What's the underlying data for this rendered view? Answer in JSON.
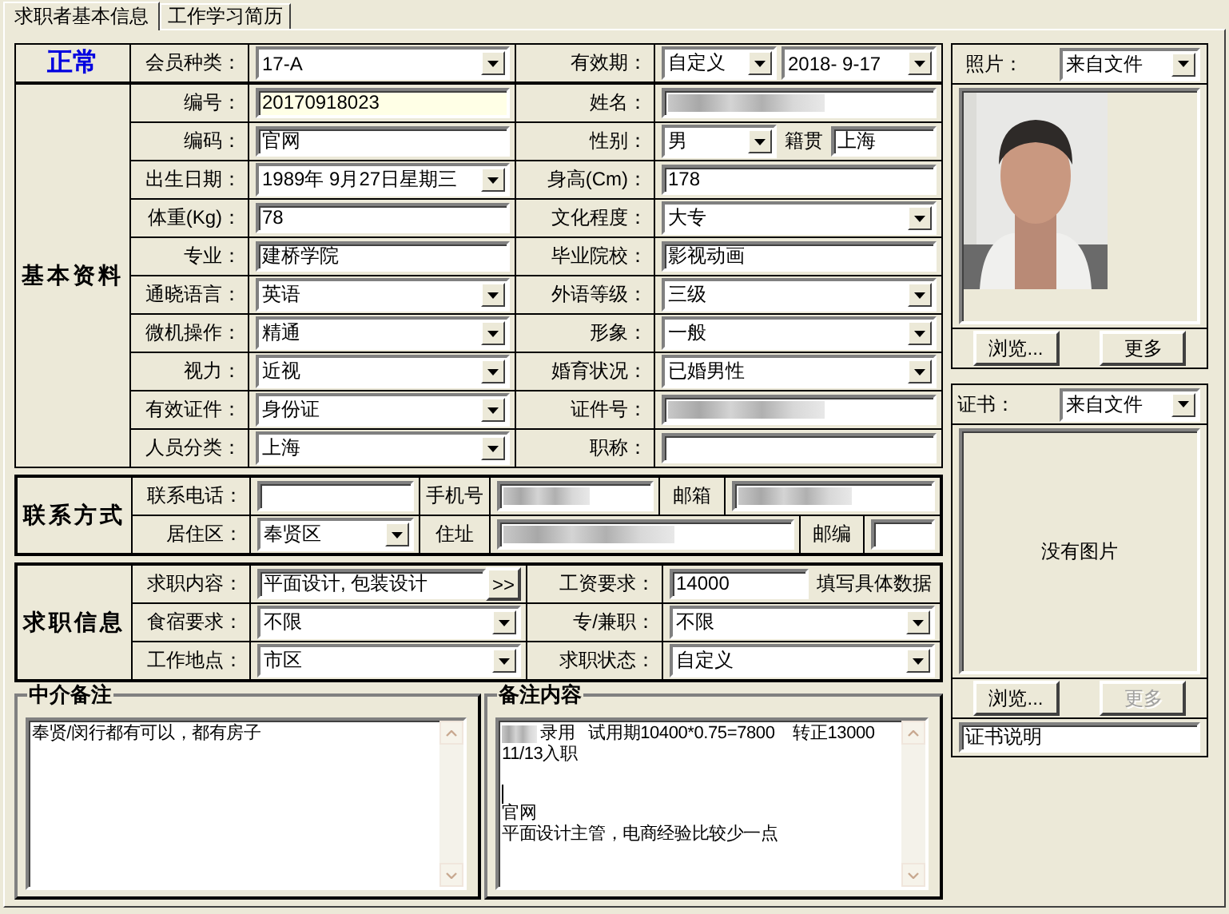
{
  "tabs": [
    {
      "label": "求职者基本信息",
      "selected": true
    },
    {
      "label": "工作学习简历",
      "selected": false
    }
  ],
  "form": {
    "sections": [
      {
        "kind": "header",
        "title": "正常",
        "rows": [
          [
            {
              "kind": "label",
              "text": "会员种类："
            },
            {
              "kind": "combo",
              "value": "17-A"
            },
            {
              "kind": "label",
              "text": "有效期："
            },
            {
              "kind": "group",
              "items": [
                {
                  "kind": "combo",
                  "value": "自定义"
                },
                {
                  "kind": "combo",
                  "value": "2018- 9-17"
                }
              ]
            }
          ]
        ]
      },
      {
        "kind": "basic",
        "title": "基本资料",
        "rows": [
          [
            {
              "kind": "label",
              "text": "编号："
            },
            {
              "kind": "field",
              "value": "20170918023",
              "highlighted": true
            },
            {
              "kind": "label",
              "text": "姓名："
            },
            {
              "kind": "field",
              "redacted": true,
              "highlighted": false
            }
          ],
          [
            {
              "kind": "label",
              "text": "编码："
            },
            {
              "kind": "field",
              "value": "官网",
              "highlighted": false
            },
            {
              "kind": "label",
              "text": "性别："
            },
            {
              "kind": "group",
              "items": [
                {
                  "kind": "combo",
                  "value": "男"
                },
                {
                  "kind": "text",
                  "text": "籍贯"
                },
                {
                  "kind": "field",
                  "value": "上海",
                  "highlighted": false
                }
              ]
            }
          ],
          [
            {
              "kind": "label",
              "text": "出生日期："
            },
            {
              "kind": "combo",
              "value": "1989年 9月27日星期三"
            },
            {
              "kind": "label",
              "text": "身高(Cm)："
            },
            {
              "kind": "field",
              "value": "178",
              "highlighted": false
            }
          ],
          [
            {
              "kind": "label",
              "text": "体重(Kg)："
            },
            {
              "kind": "field",
              "value": "78",
              "highlighted": false
            },
            {
              "kind": "label",
              "text": "文化程度："
            },
            {
              "kind": "combo",
              "value": "大专"
            }
          ],
          [
            {
              "kind": "label",
              "text": "专业："
            },
            {
              "kind": "field",
              "value": "建桥学院",
              "highlighted": false
            },
            {
              "kind": "label",
              "text": "毕业院校："
            },
            {
              "kind": "field",
              "value": "影视动画",
              "highlighted": false
            }
          ],
          [
            {
              "kind": "label",
              "text": "通晓语言："
            },
            {
              "kind": "combo",
              "value": "英语"
            },
            {
              "kind": "label",
              "text": "外语等级："
            },
            {
              "kind": "combo",
              "value": "三级"
            }
          ],
          [
            {
              "kind": "label",
              "text": "微机操作："
            },
            {
              "kind": "combo",
              "value": "精通"
            },
            {
              "kind": "label",
              "text": "形象："
            },
            {
              "kind": "combo",
              "value": "一般"
            }
          ],
          [
            {
              "kind": "label",
              "text": "视力："
            },
            {
              "kind": "combo",
              "value": "近视"
            },
            {
              "kind": "label",
              "text": "婚育状况："
            },
            {
              "kind": "combo",
              "value": "已婚男性"
            }
          ],
          [
            {
              "kind": "label",
              "text": "有效证件："
            },
            {
              "kind": "combo",
              "value": "身份证"
            },
            {
              "kind": "label",
              "text": "证件号："
            },
            {
              "kind": "field",
              "redacted": true,
              "highlighted": false
            }
          ],
          [
            {
              "kind": "label",
              "text": "人员分类："
            },
            {
              "kind": "combo",
              "value": "上海"
            },
            {
              "kind": "label",
              "text": "职称："
            },
            {
              "kind": "field",
              "highlighted": false
            }
          ]
        ]
      },
      {
        "kind": "contact",
        "title": "联系方式",
        "rows": [
          [
            {
              "kind": "label",
              "text": "联系电话："
            },
            {
              "kind": "field",
              "highlighted": false
            },
            {
              "kind": "label",
              "text": "手机号"
            },
            {
              "kind": "field",
              "redacted": true,
              "highlighted": false
            },
            {
              "kind": "label",
              "text": "邮箱"
            },
            {
              "kind": "field",
              "redacted": true,
              "highlighted": false
            }
          ],
          [
            {
              "kind": "label",
              "text": "居住区："
            },
            {
              "kind": "combo",
              "value": "奉贤区"
            },
            {
              "kind": "label",
              "text": "住址"
            },
            {
              "kind": "field",
              "redacted": true,
              "highlighted": false
            },
            {
              "kind": "label",
              "text": "邮编"
            },
            {
              "kind": "field",
              "highlighted": false
            }
          ]
        ]
      },
      {
        "kind": "job",
        "title": "求职信息",
        "rows": [
          [
            {
              "kind": "label",
              "text": "求职内容："
            },
            {
              "kind": "group",
              "items": [
                {
                  "kind": "field",
                  "value": "平面设计, 包装设计",
                  "highlighted": false
                },
                {
                  "kind": "button",
                  "label": ">>"
                }
              ]
            },
            {
              "kind": "label",
              "text": "工资要求："
            },
            {
              "kind": "group",
              "items": [
                {
                  "kind": "field",
                  "value": "14000",
                  "highlighted": false
                },
                {
                  "kind": "text",
                  "text": "填写具体数据"
                }
              ]
            }
          ],
          [
            {
              "kind": "label",
              "text": "食宿要求："
            },
            {
              "kind": "combo",
              "value": "不限"
            },
            {
              "kind": "label",
              "text": "专/兼职："
            },
            {
              "kind": "combo",
              "value": "不限"
            }
          ],
          [
            {
              "kind": "label",
              "text": "工作地点："
            },
            {
              "kind": "combo",
              "value": "市区"
            },
            {
              "kind": "label",
              "text": "求职状态："
            },
            {
              "kind": "combo",
              "value": "自定义"
            }
          ]
        ]
      }
    ],
    "notes": [
      {
        "title": "中介备注",
        "lines": [
          {
            "kind": "text",
            "text": "奉贤/闵行都有可以，都有房子",
            "redacted": false
          }
        ]
      },
      {
        "title": "备注内容",
        "lines": [
          {
            "kind": "text",
            "text": "录用   试用期10400*0.75=7800    转正13000",
            "redacted": true
          },
          {
            "kind": "text",
            "text": "11/13入职",
            "redacted": false
          },
          {
            "kind": "blank"
          },
          {
            "kind": "caret"
          },
          {
            "kind": "text",
            "text": "官网",
            "redacted": false
          },
          {
            "kind": "text",
            "text": "平面设计主管，电商经验比较少一点",
            "redacted": false
          }
        ]
      }
    ]
  },
  "photo_panel": {
    "label": "照片：",
    "source": "来自文件",
    "buttons": [
      {
        "label": "浏览...",
        "disabled": false
      },
      {
        "label": "更多",
        "disabled": false
      }
    ]
  },
  "certificate_panel": {
    "label": "证书：",
    "source": "来自文件",
    "empty_text": "没有图片",
    "buttons": [
      {
        "label": "浏览...",
        "disabled": false
      },
      {
        "label": "更多",
        "disabled": true
      }
    ],
    "caption": "证书说明"
  }
}
